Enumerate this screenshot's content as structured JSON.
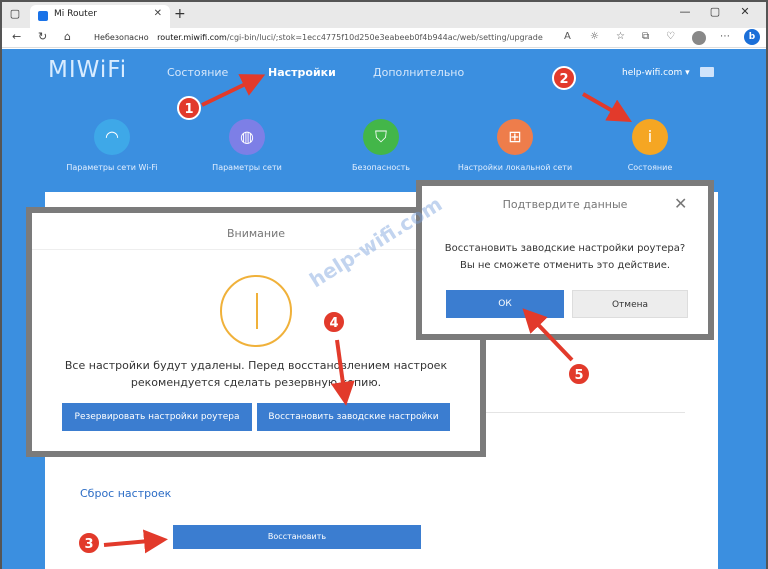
{
  "browser": {
    "tab_title": "Mi Router",
    "url_warning": "Небезопасно",
    "url_host": "router.miwifi.com",
    "url_path": "/cgi-bin/luci/;stok=1ecc4775f10d250e3eabeeb0f4b944ac/web/setting/upgrade"
  },
  "header": {
    "brand": "MIWiFi",
    "nav": [
      "Состояние",
      "Настройки",
      "Дополнительно"
    ],
    "user": "help-wifi.com ▾"
  },
  "features": [
    {
      "label": "Параметры сети Wi-Fi",
      "icon": "wifi-icon",
      "color": "#3ea8e8"
    },
    {
      "label": "Параметры сети",
      "icon": "globe-icon",
      "color": "#7d7fe6"
    },
    {
      "label": "Безопасность",
      "icon": "shield-icon",
      "color": "#43b649"
    },
    {
      "label": "Настройки локальной сети",
      "icon": "network-icon",
      "color": "#ee7d4b"
    },
    {
      "label": "Состояние",
      "icon": "info-icon",
      "color": "#f5a623"
    }
  ],
  "content": {
    "reset_link": "Сброс настроек",
    "restore_button": "Восстановить"
  },
  "warning_dialog": {
    "title": "Внимание",
    "text_line1": "Все настройки будут удалены. Перед восстановлением настроек",
    "text_line2": "рекомендуется сделать резервную копию.",
    "backup_button": "Резервировать настройки роутера",
    "restore_button": "Восстановить заводские настройки"
  },
  "confirm_dialog": {
    "title": "Подтвердите данные",
    "text_line1": "Восстановить заводские настройки роутера?",
    "text_line2": "Вы не сможете отменить это действие.",
    "ok_button": "ОК",
    "cancel_button": "Отмена"
  },
  "steps": [
    "1",
    "2",
    "3",
    "4",
    "5"
  ],
  "watermark": "help-wifi.com",
  "colors": {
    "accent": "#3b7dd0",
    "step": "#e23a2b",
    "page_bg": "#3b8fe0"
  }
}
